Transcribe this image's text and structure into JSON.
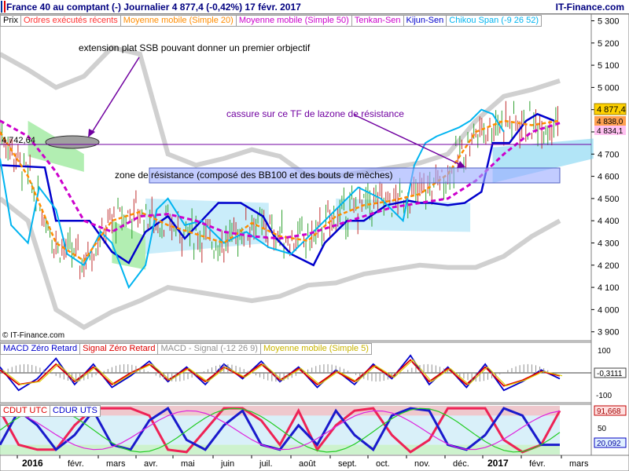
{
  "header": {
    "title": "France 40 au comptant (-)   Journalier   4 877,4 (-0,42%)   17 févr. 2017",
    "site": "IT-Finance.com"
  },
  "main_legend": [
    "Prix",
    "Ordres exécutés récents",
    "Moyenne mobile (Simple 20)",
    "Moyenne mobile (Simple 50)",
    "Tenkan-Sen",
    "Kijun-Sen",
    "Chikou Span (-9 26 52)"
  ],
  "macd_legend": [
    "MACD Zéro Retard",
    "Signal Zéro Retard",
    "MACD - Signal (-12 26 9)",
    "Moyenne mobile (Simple 5)"
  ],
  "cdut_legend": [
    "CDUT UTC",
    "CDUR UTS"
  ],
  "copyright": "© IT-Finance.com",
  "annotations": {
    "ssb": "extension plat SSB pouvant donner un premier orbjectif",
    "breakout": "cassure sur ce TF de lazone de résistance",
    "zone": "zone de résistance (composé des BB100 et des bouts de mèches)",
    "level": "4 742,64"
  },
  "price_labels": {
    "last": "4 877,4",
    "ma20": "4 838,0",
    "ma50": "4 834,1"
  },
  "macd_labels": {
    "v1": "-0,3111",
    "top": "100",
    "bottom": "-100"
  },
  "cdut_labels": {
    "v1": "91,668",
    "v2": "20,092",
    "mid": "50"
  },
  "colors": {
    "tenkan": "#cc00cc",
    "kijun": "#0000cc",
    "chikou": "#00b4f0",
    "ma20": "#ff8c00",
    "ma50": "#cc00cc",
    "cloud_green": "#66dd66",
    "cloud_blue": "#66ccf0",
    "bb": "#b0b0b0",
    "macd": "#0000cc",
    "signal": "#dd0000",
    "ma5": "#ddcc00"
  },
  "chart_data": [
    {
      "type": "line",
      "title": "France 40 au comptant (-) Journalier",
      "y_axis_ticks": [
        3900,
        4000,
        4100,
        4200,
        4300,
        4400,
        4500,
        4600,
        4700,
        4800,
        4900,
        5000,
        5100,
        5200,
        5300
      ],
      "y_axis_tick_labels": [
        "3 900",
        "4 000",
        "4 100",
        "4 200",
        "4 300",
        "4 400",
        "4 500",
        "4 600",
        "4 700",
        "4 800",
        "4 900",
        "5 000",
        "5 100",
        "5 200",
        "5 300"
      ],
      "ylim": [
        3860,
        5330
      ],
      "x_tick_labels": [
        "2016",
        "févr.",
        "mars",
        "avr.",
        "mai",
        "juin",
        "juil.",
        "août",
        "sept.",
        "oct.",
        "nov.",
        "déc.",
        "2017",
        "févr.",
        "mars"
      ],
      "resistance_zone": [
        4565,
        4630
      ],
      "horizontal_level": 4742.64,
      "series": [
        {
          "name": "Kijun-Sen",
          "x": [
            0,
            8,
            10,
            16,
            20,
            23,
            26,
            30,
            33,
            36,
            39,
            43,
            47,
            49,
            52,
            56,
            58,
            62,
            65,
            69,
            73,
            75,
            77,
            80,
            83,
            86,
            88,
            91,
            94,
            96,
            99
          ],
          "values": [
            4650,
            4640,
            4400,
            4400,
            4260,
            4210,
            4350,
            4420,
            4320,
            4400,
            4480,
            4480,
            4420,
            4330,
            4250,
            4200,
            4300,
            4400,
            4400,
            4470,
            4490,
            4480,
            4480,
            4470,
            4480,
            4530,
            4750,
            4750,
            4850,
            4880,
            4850
          ]
        },
        {
          "name": "Chikou Span",
          "x": [
            0,
            2,
            5,
            7,
            10,
            12,
            15,
            18,
            20,
            23,
            26,
            28,
            30,
            33,
            36,
            40,
            44,
            48,
            52,
            56,
            60,
            64,
            68,
            72,
            74,
            76,
            78,
            80,
            82,
            84,
            86,
            88,
            90
          ],
          "values": [
            4680,
            4380,
            4300,
            4550,
            4450,
            4250,
            4200,
            4350,
            4300,
            4100,
            4200,
            4450,
            4500,
            4380,
            4400,
            4300,
            4350,
            4280,
            4250,
            4350,
            4450,
            4550,
            4500,
            4400,
            4650,
            4750,
            4780,
            4800,
            4820,
            4850,
            4900,
            4880,
            4800
          ]
        },
        {
          "name": "Moyenne mobile (Simple 20)",
          "x": [
            0,
            5,
            10,
            15,
            18,
            20,
            25,
            30,
            35,
            40,
            45,
            50,
            55,
            60,
            65,
            70,
            75,
            80,
            85,
            90,
            95,
            100
          ],
          "values": [
            4800,
            4600,
            4300,
            4220,
            4330,
            4400,
            4440,
            4380,
            4340,
            4300,
            4390,
            4330,
            4310,
            4420,
            4470,
            4490,
            4520,
            4610,
            4800,
            4850,
            4830,
            4850
          ]
        },
        {
          "name": "Moyenne mobile (Simple 50)",
          "x": [
            0,
            5,
            10,
            15,
            20,
            25,
            30,
            35,
            40,
            45,
            50,
            55,
            60,
            65,
            70,
            75,
            80,
            85,
            90,
            95,
            100
          ],
          "values": [
            4850,
            4780,
            4620,
            4400,
            4350,
            4420,
            4430,
            4400,
            4350,
            4330,
            4320,
            4340,
            4380,
            4420,
            4460,
            4480,
            4500,
            4580,
            4700,
            4800,
            4840
          ]
        }
      ]
    },
    {
      "type": "line",
      "title": "MACD Zéro Retard",
      "ylim": [
        -100,
        100
      ],
      "y_axis_tick_labels": [
        "100",
        "-100"
      ],
      "series": [
        {
          "name": "MACD Zéro Retard",
          "values": [
            20,
            -60,
            -20,
            50,
            -40,
            30,
            -50,
            -10,
            40,
            -30,
            20,
            -40,
            30,
            -20,
            40,
            -30,
            20,
            -50,
            10,
            -40,
            30,
            -20,
            60,
            -40,
            20,
            -50,
            30,
            -60,
            -30,
            10,
            -20
          ]
        },
        {
          "name": "Signal Zéro Retard",
          "values": [
            10,
            -40,
            -30,
            30,
            -30,
            20,
            -40,
            0,
            30,
            -25,
            15,
            -30,
            20,
            -15,
            30,
            -25,
            15,
            -40,
            5,
            -30,
            25,
            -15,
            45,
            -30,
            15,
            -40,
            20,
            -45,
            -25,
            5,
            -10
          ]
        }
      ]
    },
    {
      "type": "line",
      "title": "CDUT UTC",
      "ylim": [
        0,
        100
      ],
      "y_axis_tick_labels": [
        "50"
      ],
      "series": [
        {
          "name": "CDUT UTC",
          "values": [
            90,
            20,
            10,
            10,
            60,
            95,
            95,
            95,
            80,
            10,
            5,
            50,
            95,
            95,
            70,
            20,
            90,
            10,
            60,
            90,
            95,
            40,
            5,
            30,
            95,
            95,
            95,
            30,
            5,
            20,
            90
          ]
        },
        {
          "name": "CDUR UTS",
          "values": [
            20,
            90,
            60,
            10,
            40,
            90,
            20,
            10,
            70,
            95,
            30,
            10,
            60,
            90,
            20,
            10,
            60,
            20,
            90,
            40,
            10,
            80,
            95,
            90,
            20,
            10,
            40,
            95,
            80,
            20,
            20
          ]
        }
      ]
    }
  ]
}
